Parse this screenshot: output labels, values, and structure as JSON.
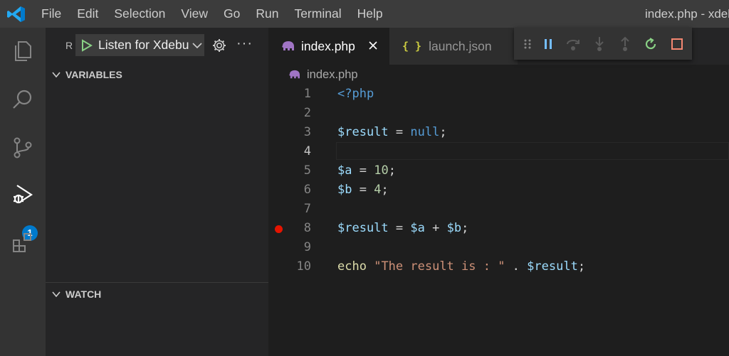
{
  "menu": [
    "File",
    "Edit",
    "Selection",
    "View",
    "Go",
    "Run",
    "Terminal",
    "Help"
  ],
  "window_title": "index.php - xdebu",
  "activity_badge": "1",
  "sidebar": {
    "run_label": "R",
    "launch_config": "Listen for Xdebug",
    "more": "···",
    "variables_title": "VARIABLES",
    "watch_title": "WATCH"
  },
  "tabs": [
    {
      "label": "index.php",
      "active": true
    },
    {
      "label": "launch.json",
      "active": false,
      "icon": "{ }"
    }
  ],
  "breadcrumb": "index.php",
  "code_lines": [
    {
      "n": "1",
      "tokens": [
        [
          "kw",
          "<?php"
        ]
      ]
    },
    {
      "n": "2",
      "tokens": []
    },
    {
      "n": "3",
      "tokens": [
        [
          "var",
          "$result"
        ],
        [
          "op",
          " = "
        ],
        [
          "kw",
          "null"
        ],
        [
          "op",
          ";"
        ]
      ]
    },
    {
      "n": "4",
      "tokens": [],
      "current": true
    },
    {
      "n": "5",
      "tokens": [
        [
          "var",
          "$a"
        ],
        [
          "op",
          " = "
        ],
        [
          "num",
          "10"
        ],
        [
          "op",
          ";"
        ]
      ]
    },
    {
      "n": "6",
      "tokens": [
        [
          "var",
          "$b"
        ],
        [
          "op",
          " = "
        ],
        [
          "num",
          "4"
        ],
        [
          "op",
          ";"
        ]
      ]
    },
    {
      "n": "7",
      "tokens": []
    },
    {
      "n": "8",
      "tokens": [
        [
          "var",
          "$result"
        ],
        [
          "op",
          " = "
        ],
        [
          "var",
          "$a"
        ],
        [
          "op",
          " + "
        ],
        [
          "var",
          "$b"
        ],
        [
          "op",
          ";"
        ]
      ],
      "breakpoint": true
    },
    {
      "n": "9",
      "tokens": []
    },
    {
      "n": "10",
      "tokens": [
        [
          "fn",
          "echo"
        ],
        [
          "op",
          " "
        ],
        [
          "str",
          "\"The result is : \""
        ],
        [
          "op",
          " . "
        ],
        [
          "var",
          "$result"
        ],
        [
          "op",
          ";"
        ]
      ]
    }
  ],
  "debug_toolbar": [
    "drag-handle-icon",
    "pause-icon",
    "step-over-icon",
    "step-into-icon",
    "step-out-icon",
    "restart-icon",
    "stop-icon"
  ],
  "colors": {
    "accent": "#007acc",
    "breakpoint": "#e51400",
    "restart": "#89d185",
    "stop": "#f48771",
    "pause": "#75beff"
  }
}
